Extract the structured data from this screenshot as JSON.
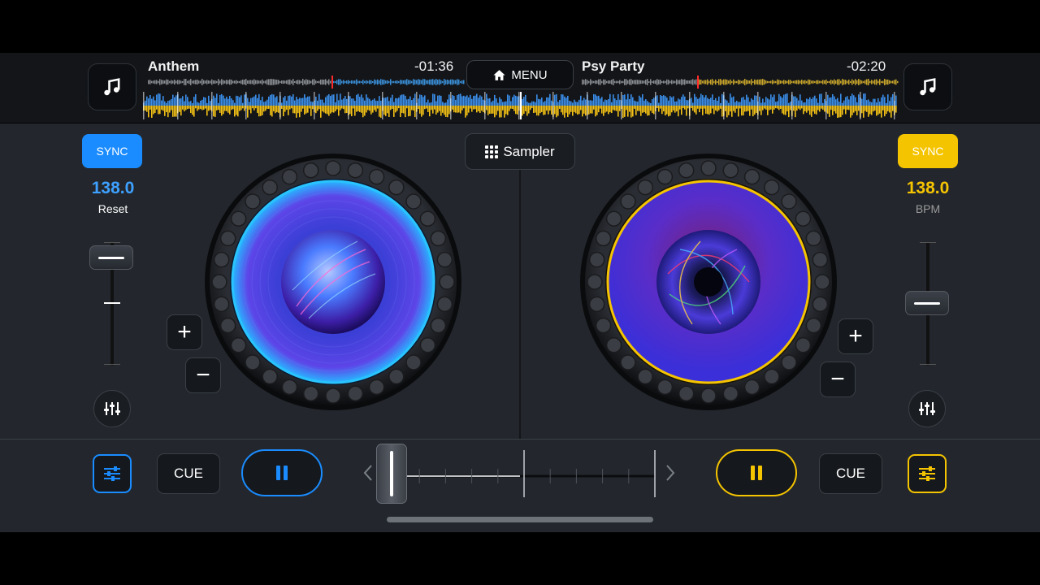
{
  "deckA": {
    "title": "Anthem",
    "time": "-01:36",
    "sync_label": "SYNC",
    "bpm": "138.0",
    "bpm_sub": "Reset",
    "cue_label": "CUE",
    "accent": "#1a8cff"
  },
  "deckB": {
    "title": "Psy Party",
    "time": "-02:20",
    "sync_label": "SYNC",
    "bpm": "138.0",
    "bpm_sub": "BPM",
    "cue_label": "CUE",
    "accent": "#f5c400"
  },
  "menu": {
    "label": "MENU",
    "icon": "home-icon"
  },
  "sampler": {
    "label": "Sampler",
    "icon": "grid-icon"
  },
  "pitch": {
    "plus": "+",
    "minus": "−"
  },
  "icons": {
    "library": "music-note-icon",
    "pause": "pause-icon",
    "eq": "sliders-icon",
    "mixer": "mixer-icon",
    "chevron_left": "chevron-left-icon",
    "chevron_right": "chevron-right-icon"
  },
  "crossfader": {
    "position": 0.05
  },
  "colors": {
    "background": "#23272d",
    "topbar": "#131519"
  }
}
